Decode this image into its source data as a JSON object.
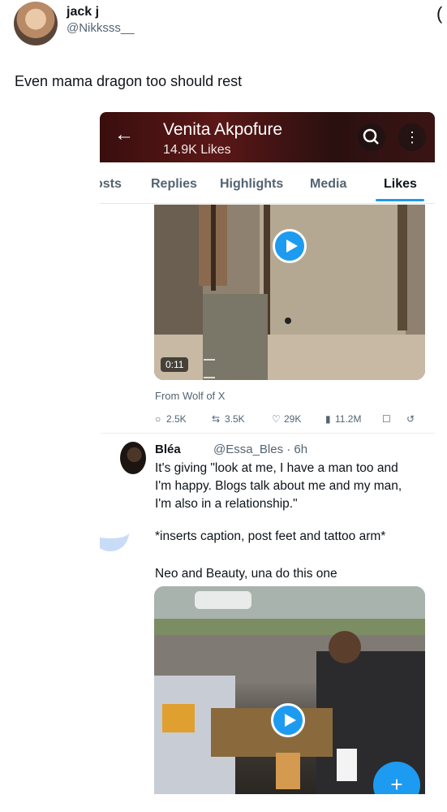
{
  "post": {
    "author_name": "jack j",
    "author_handle": "@Nikksss__",
    "text": "Even mama dragon too should rest"
  },
  "screenshot": {
    "profile_name": "Venita Akpofure",
    "profile_likes": "14.9K Likes",
    "tabs": [
      "osts",
      "Replies",
      "Highlights",
      "Media",
      "Likes"
    ],
    "active_tab": "Likes",
    "video1": {
      "duration": "0:11",
      "from": "From Wolf of X",
      "stats": {
        "replies": "2.5K",
        "reposts": "3.5K",
        "likes": "29K",
        "views": "11.2M"
      }
    },
    "tweet": {
      "name": "Bléa",
      "handle_time": "@Essa_Bles · 6h",
      "line1": "It's giving \"look at me, I have a man too and",
      "line2": "I'm happy. Blogs talk about me and my man,",
      "line3": "I'm also in a relationship.\"",
      "line4": "*inserts caption, post feet and tattoo arm*",
      "line5": "Neo and Beauty, una do this one"
    }
  },
  "icons": [
    "back-arrow-icon",
    "search-icon",
    "more-icon",
    "play-icon",
    "reply-icon",
    "repost-icon",
    "heart-icon",
    "views-icon",
    "bookmark-icon",
    "share-icon",
    "plus-icon"
  ],
  "colors": {
    "accent": "#1d9bf0",
    "header_bg": "#4a1414"
  }
}
